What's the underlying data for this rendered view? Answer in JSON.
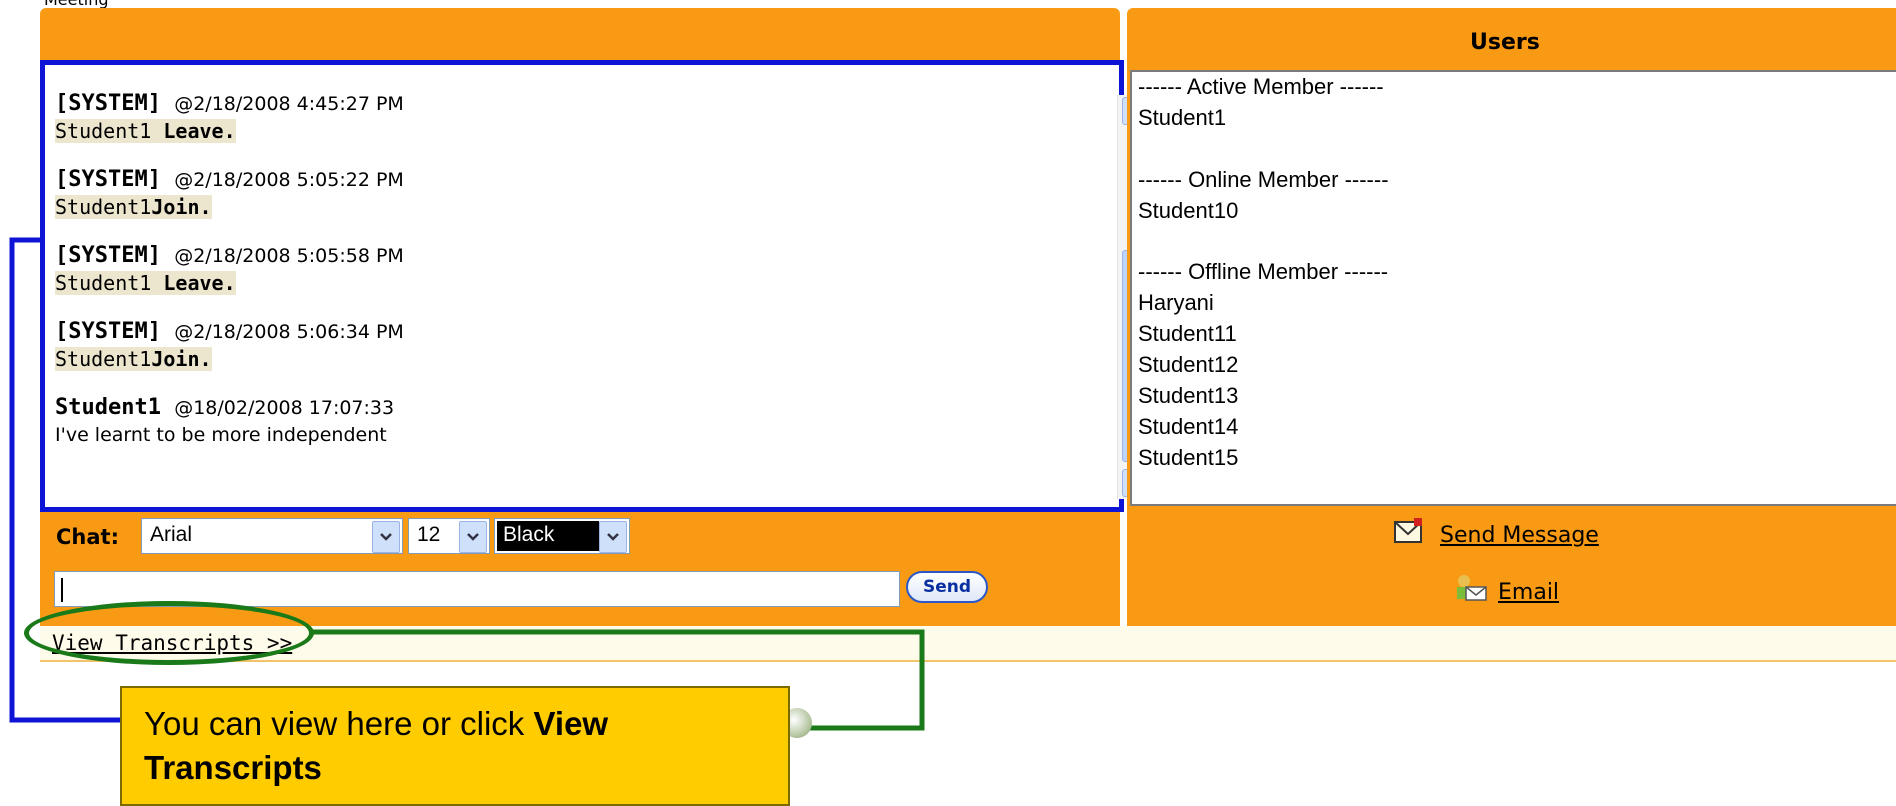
{
  "header_clip": "Meeting",
  "chat": {
    "messages": [
      {
        "sender": "[SYSTEM]",
        "timestamp": "@2/18/2008 4:45:27 PM",
        "user": "Student1",
        "action": " Leave."
      },
      {
        "sender": "[SYSTEM]",
        "timestamp": "@2/18/2008 5:05:22 PM",
        "user": "Student1",
        "action": "Join."
      },
      {
        "sender": "[SYSTEM]",
        "timestamp": "@2/18/2008 5:05:58 PM",
        "user": "Student1",
        "action": " Leave."
      },
      {
        "sender": "[SYSTEM]",
        "timestamp": "@2/18/2008 5:06:34 PM",
        "user": "Student1",
        "action": "Join."
      },
      {
        "sender": "Student1",
        "timestamp": "@18/02/2008 17:07:33",
        "text": "I've learnt to be more independent"
      }
    ],
    "label": "Chat:",
    "font_select": "Arial",
    "size_select": "12",
    "color_select": "Black",
    "input_value": "",
    "send_label": "Send"
  },
  "users": {
    "title": "Users",
    "active_header": "------ Active Member ------",
    "active": [
      "Student1"
    ],
    "online_header": "------ Online Member ------",
    "online": [
      "Student10"
    ],
    "offline_header": "------ Offline Member ------",
    "offline": [
      "Haryani",
      "Student11",
      "Student12",
      "Student13",
      "Student14",
      "Student15"
    ],
    "send_message_label": "Send Message",
    "email_label": "Email"
  },
  "transcripts_link": "View Transcripts >>",
  "callout": {
    "text_plain": "You can view here or click ",
    "text_bold": "View Transcripts"
  },
  "colors": {
    "panel": "#f89a14",
    "chat_border": "#0d14d6",
    "annotation_green": "#1a7a1a",
    "callout": "#ffcc00"
  }
}
